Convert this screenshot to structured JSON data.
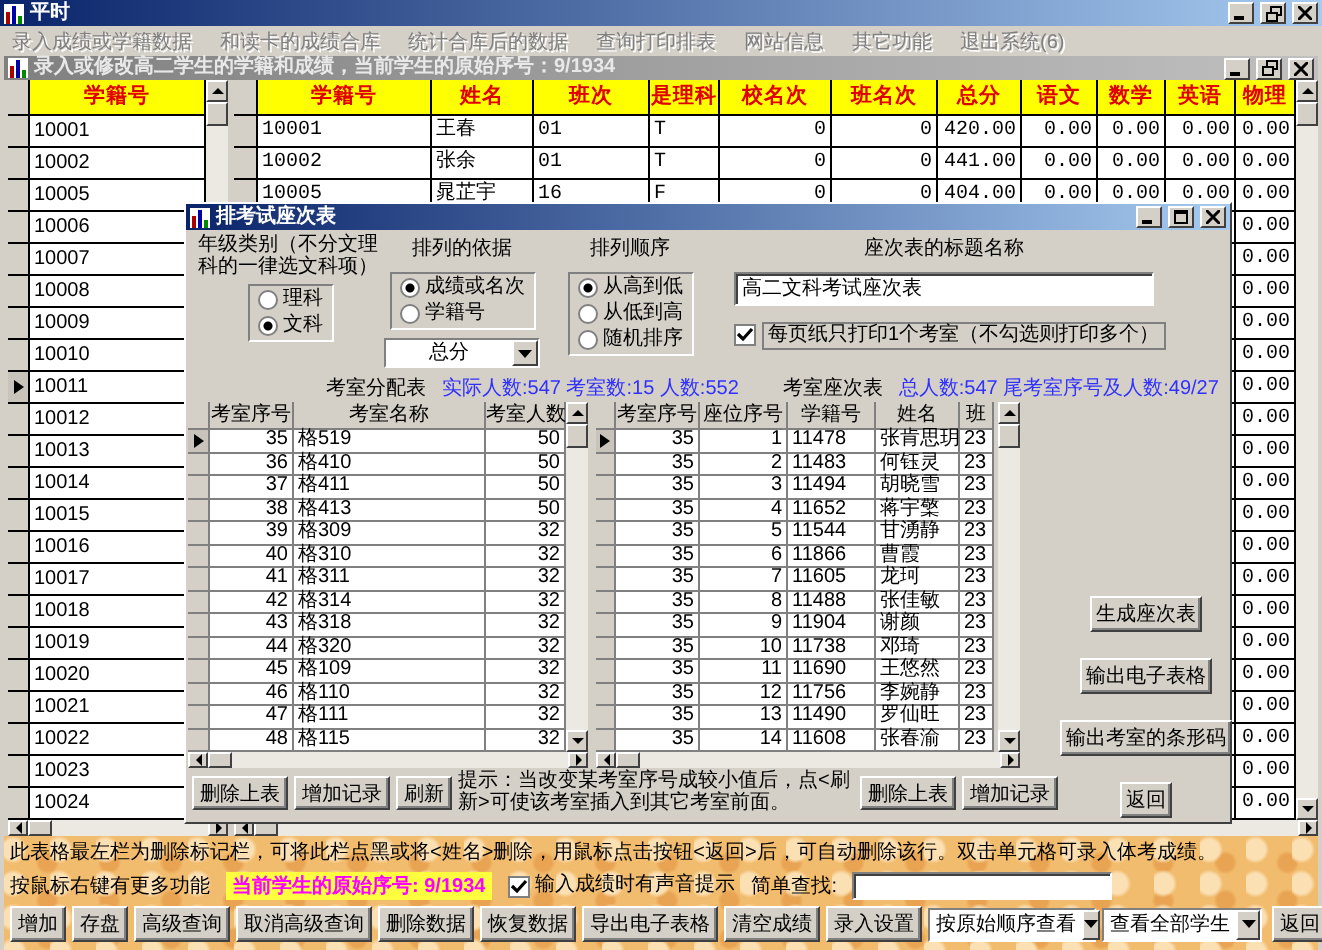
{
  "window": {
    "title": "平时"
  },
  "menu": [
    {
      "label": "录入成绩或学籍数据",
      "disabled": true
    },
    {
      "label": "和读卡的成绩合库",
      "disabled": true
    },
    {
      "label": "统计合库后的数据",
      "disabled": true
    },
    {
      "label": "查询打印排表",
      "disabled": true
    },
    {
      "label": "网站信息",
      "disabled": true
    },
    {
      "label": "其它功能",
      "disabled": true
    },
    {
      "label": "退出系统(6)",
      "disabled": true
    }
  ],
  "child_window": {
    "title": "录入或修改高二学生的学籍和成绩，当前学生的原始序号：9/1934"
  },
  "id_list": {
    "column": "学籍号",
    "rows": [
      {
        "id": "10001",
        "current": false
      },
      {
        "id": "10002",
        "current": false
      },
      {
        "id": "10005",
        "current": false
      },
      {
        "id": "10006",
        "current": false
      },
      {
        "id": "10007",
        "current": false
      },
      {
        "id": "10008",
        "current": false
      },
      {
        "id": "10009",
        "current": false
      },
      {
        "id": "10010",
        "current": false
      },
      {
        "id": "10011",
        "current": true
      },
      {
        "id": "10012",
        "current": false
      },
      {
        "id": "10013",
        "current": false
      },
      {
        "id": "10014",
        "current": false
      },
      {
        "id": "10015",
        "current": false
      },
      {
        "id": "10016",
        "current": false
      },
      {
        "id": "10017",
        "current": false
      },
      {
        "id": "10018",
        "current": false
      },
      {
        "id": "10019",
        "current": false
      },
      {
        "id": "10020",
        "current": false
      },
      {
        "id": "10021",
        "current": false
      },
      {
        "id": "10022",
        "current": false
      },
      {
        "id": "10023",
        "current": false
      },
      {
        "id": "10024",
        "current": false
      }
    ]
  },
  "student_grid": {
    "columns": [
      "学籍号",
      "姓名",
      "班次",
      "是理科",
      "校名次",
      "班名次",
      "总分",
      "语文",
      "数学",
      "英语",
      "物理"
    ],
    "rows": [
      {
        "cells": [
          "10001",
          "王春",
          "01",
          "T",
          "0",
          "0",
          "420.00",
          "0.00",
          "0.00",
          "0.00",
          "0.00"
        ]
      },
      {
        "cells": [
          "10002",
          "张余",
          "01",
          "T",
          "0",
          "0",
          "441.00",
          "0.00",
          "0.00",
          "0.00",
          "0.00"
        ]
      },
      {
        "cells": [
          "10005",
          "晁芷宇",
          "16",
          "F",
          "0",
          "0",
          "404.00",
          "0.00",
          "0.00",
          "0.00",
          "0.00"
        ]
      }
    ],
    "covered_rows": [
      {
        "physics": "0.00"
      },
      {
        "physics": "0.00"
      },
      {
        "physics": "0.00"
      },
      {
        "physics": "0.00"
      },
      {
        "physics": "0.00"
      },
      {
        "physics": "0.00"
      },
      {
        "physics": "0.00"
      },
      {
        "physics": "0.00"
      },
      {
        "physics": "0.00"
      },
      {
        "physics": "0.00"
      },
      {
        "physics": "0.00"
      },
      {
        "physics": "0.00"
      },
      {
        "physics": "0.00"
      },
      {
        "physics": "0.00"
      },
      {
        "physics": "0.00"
      },
      {
        "physics": "0.00"
      },
      {
        "physics": "0.00"
      },
      {
        "physics": "0.00"
      },
      {
        "physics": "0.00"
      }
    ]
  },
  "dialog": {
    "title": "排考试座次表",
    "grade_type": {
      "label": "年级类别（不分文理科的一律选文科项）",
      "options": [
        {
          "label": "理科",
          "selected": false
        },
        {
          "label": "文科",
          "selected": true
        }
      ]
    },
    "sort_basis": {
      "label": "排列的依据",
      "options": [
        {
          "label": "成绩或名次",
          "selected": true
        },
        {
          "label": "学籍号",
          "selected": false
        }
      ],
      "dropdown": "总分"
    },
    "sort_order": {
      "label": "排列顺序",
      "options": [
        {
          "label": "从高到低",
          "selected": true
        },
        {
          "label": "从低到高",
          "selected": false
        },
        {
          "label": "随机排序",
          "selected": false
        }
      ]
    },
    "table_title": {
      "label": "座次表的标题名称",
      "value": "高二文科考试座次表"
    },
    "one_room_per_page": {
      "label": "每页纸只打印1个考室（不勾选则打印多个）",
      "checked": true
    },
    "room_table": {
      "title": "考室分配表",
      "summary": "实际人数:547 考室数:15 人数:552",
      "columns": [
        "考室序号",
        "考室名称",
        "考室人数"
      ],
      "rows": [
        {
          "cells": [
            "35",
            "格519",
            "50"
          ],
          "current": true
        },
        {
          "cells": [
            "36",
            "格410",
            "50"
          ],
          "current": false
        },
        {
          "cells": [
            "37",
            "格411",
            "50"
          ],
          "current": false
        },
        {
          "cells": [
            "38",
            "格413",
            "50"
          ],
          "current": false
        },
        {
          "cells": [
            "39",
            "格309",
            "32"
          ],
          "current": false
        },
        {
          "cells": [
            "40",
            "格310",
            "32"
          ],
          "current": false
        },
        {
          "cells": [
            "41",
            "格311",
            "32"
          ],
          "current": false
        },
        {
          "cells": [
            "42",
            "格314",
            "32"
          ],
          "current": false
        },
        {
          "cells": [
            "43",
            "格318",
            "32"
          ],
          "current": false
        },
        {
          "cells": [
            "44",
            "格320",
            "32"
          ],
          "current": false
        },
        {
          "cells": [
            "45",
            "格109",
            "32"
          ],
          "current": false
        },
        {
          "cells": [
            "46",
            "格110",
            "32"
          ],
          "current": false
        },
        {
          "cells": [
            "47",
            "格111",
            "32"
          ],
          "current": false
        },
        {
          "cells": [
            "48",
            "格115",
            "32"
          ],
          "current": false
        }
      ]
    },
    "seat_table": {
      "title": "考室座次表",
      "summary": "总人数:547 尾考室序号及人数:49/27",
      "columns": [
        "考室序号",
        "座位序号",
        "学籍号",
        "姓名",
        "班"
      ],
      "rows": [
        {
          "cells": [
            "35",
            "1",
            "11478",
            "张肯思玥",
            "23"
          ],
          "current": true
        },
        {
          "cells": [
            "35",
            "2",
            "11483",
            "何钰灵",
            "23"
          ],
          "current": false
        },
        {
          "cells": [
            "35",
            "3",
            "11494",
            "胡晓雪",
            "23"
          ],
          "current": false
        },
        {
          "cells": [
            "35",
            "4",
            "11652",
            "蒋宇檠",
            "23"
          ],
          "current": false
        },
        {
          "cells": [
            "35",
            "5",
            "11544",
            "甘湧静",
            "23"
          ],
          "current": false
        },
        {
          "cells": [
            "35",
            "6",
            "11866",
            "曹霞",
            "23"
          ],
          "current": false
        },
        {
          "cells": [
            "35",
            "7",
            "11605",
            "龙珂",
            "23"
          ],
          "current": false
        },
        {
          "cells": [
            "35",
            "8",
            "11488",
            "张佳敏",
            "23"
          ],
          "current": false
        },
        {
          "cells": [
            "35",
            "9",
            "11904",
            "谢颜",
            "23"
          ],
          "current": false
        },
        {
          "cells": [
            "35",
            "10",
            "11738",
            "邓琦",
            "23"
          ],
          "current": false
        },
        {
          "cells": [
            "35",
            "11",
            "11690",
            "王悠然",
            "23"
          ],
          "current": false
        },
        {
          "cells": [
            "35",
            "12",
            "11756",
            "李婉静",
            "23"
          ],
          "current": false
        },
        {
          "cells": [
            "35",
            "13",
            "11490",
            "罗仙旺",
            "23"
          ],
          "current": false
        },
        {
          "cells": [
            "35",
            "14",
            "11608",
            "张春渝",
            "23"
          ],
          "current": false
        }
      ]
    },
    "room_buttons": [
      "删除上表",
      "增加记录",
      "刷新"
    ],
    "hint": "提示：当改变某考室序号成较小值后，点<刷新>可使该考室插入到其它考室前面。",
    "seat_buttons": [
      "删除上表",
      "增加记录"
    ],
    "action_buttons": [
      "生成座次表",
      "输出电子表格",
      "输出考室的条形码",
      "返回"
    ]
  },
  "footer": {
    "note": "此表格最左栏为删除标记栏，可将此栏点黑或将<姓名>删除，用鼠标点击按钮<返回>后，可自动删除该行。双击单元格可录入体考成绩。",
    "right_click_hint": "按鼠标右键有更多功能",
    "current_index": "当前学生的原始序号: 9/1934",
    "sound_prompt": {
      "label": "输入成绩时有声音提示",
      "checked": true
    },
    "search_label": "简单查找:",
    "buttons": [
      "增加",
      "存盘",
      "高级查询",
      "取消高级查询",
      "删除数据",
      "恢复数据",
      "导出电子表格",
      "清空成绩",
      "录入设置"
    ],
    "dropdowns": [
      "按原始顺序查看",
      "查看全部学生"
    ],
    "back_button": "返回"
  }
}
